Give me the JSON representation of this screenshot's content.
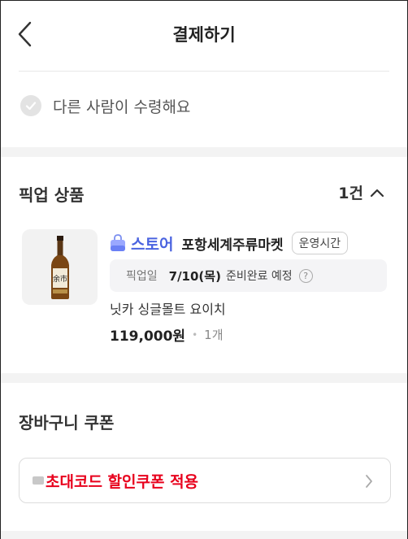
{
  "header": {
    "title": "결제하기"
  },
  "recipient": {
    "label": "다른 사람이 수령해요",
    "checked": false
  },
  "pickup_section": {
    "title": "픽업 상품",
    "count": "1건",
    "expanded": true
  },
  "store": {
    "badge": "스토어",
    "name": "포항세계주류마켓",
    "hours_button": "운영시간"
  },
  "pickup_info": {
    "label": "픽업일",
    "date": "7/10(목)",
    "status": "준비완료 예정",
    "help": "?"
  },
  "product": {
    "name": "닛카 싱글몰트 요이치",
    "price": "119,000원",
    "separator": "•",
    "quantity": "1개"
  },
  "coupon_section": {
    "title": "장바구니 쿠폰",
    "button_text": "초대코드 할인쿠폰 적용"
  },
  "colors": {
    "accent_blue": "#4a63e0",
    "coupon_red": "#e8001c"
  }
}
